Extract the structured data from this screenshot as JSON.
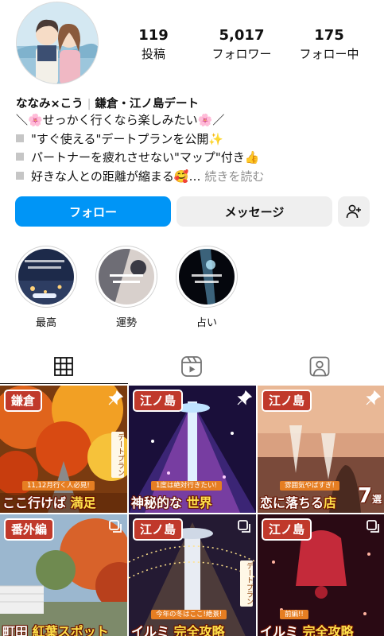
{
  "profile": {
    "stats": [
      {
        "value": "119",
        "label": "投稿"
      },
      {
        "value": "5,017",
        "label": "フォロワー"
      },
      {
        "value": "175",
        "label": "フォロー中"
      }
    ],
    "name": "ななみ×こう",
    "category": "鎌倉・江ノ島デート",
    "bio": {
      "line1": "＼🌸せっかく行くなら楽しみたい🌸／",
      "line2": "\"すぐ使える\"デートプランを公開✨",
      "line3": "パートナーを疲れさせない\"マップ\"付き👍",
      "line4": "好きな人との距離が縮まる🥰…",
      "more": "続きを読む"
    }
  },
  "buttons": {
    "follow": "フォロー",
    "message": "メッセージ",
    "add_user_icon": "add-person-icon"
  },
  "highlights": [
    {
      "label": "最高"
    },
    {
      "label": "運勢"
    },
    {
      "label": "占い"
    }
  ],
  "tabs": [
    {
      "icon": "grid-icon",
      "active": true
    },
    {
      "icon": "reels-icon",
      "active": false
    },
    {
      "icon": "tagged-icon",
      "active": false
    }
  ],
  "posts": [
    {
      "tag": "鎌倉",
      "ribbon": "11,12月行く人必見!",
      "caption_a": "ここ行けば",
      "caption_b": "満足",
      "side": "デートプラン",
      "icon": "pin-icon",
      "tag_color": "#c0392b"
    },
    {
      "tag": "江ノ島",
      "ribbon": "1度は絶対行きたい!",
      "caption_a": "神秘的な",
      "caption_b": "世界",
      "icon": "pin-icon",
      "tag_color": "#c0392b"
    },
    {
      "tag": "江ノ島",
      "ribbon": "雰囲気やばすぎ!",
      "caption_a": "恋に落ちる",
      "caption_b": "店",
      "number": "7",
      "number_suffix": "選",
      "icon": "pin-icon",
      "tag_color": "#c0392b"
    },
    {
      "tag": "番外編",
      "caption_a": "町田",
      "caption_b": "紅葉スポット",
      "icon": "multi-icon",
      "tag_color": "#c0392b"
    },
    {
      "tag": "江ノ島",
      "ribbon": "今年の冬はここ!絶景!",
      "caption_a": "イルミ",
      "caption_b": "完全攻略",
      "side": "デートプラン",
      "icon": "multi-icon",
      "tag_color": "#c0392b"
    },
    {
      "tag": "江ノ島",
      "ribbon": "前編!!",
      "caption_a": "イルミ",
      "caption_b": "完全攻略",
      "icon": "multi-icon",
      "tag_color": "#c0392b"
    }
  ]
}
